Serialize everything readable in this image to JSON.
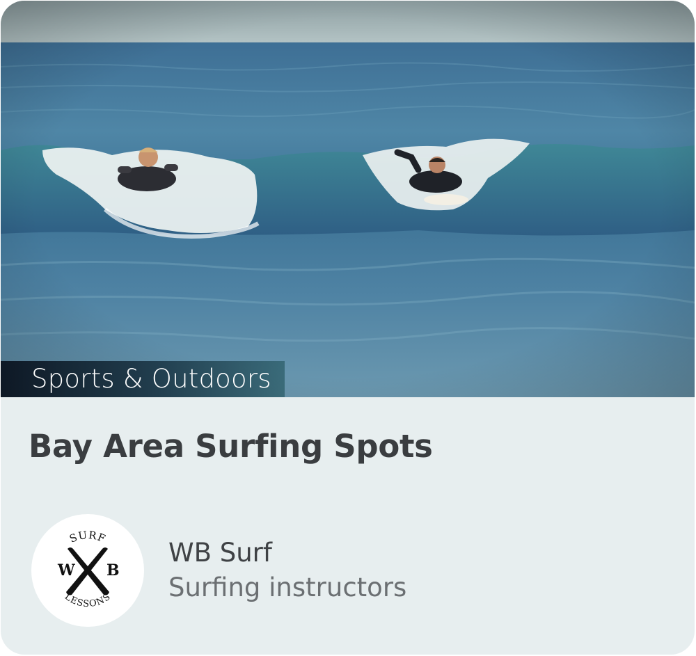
{
  "card": {
    "category": "Sports & Outdoors",
    "title": "Bay Area Surfing Spots",
    "hero_image": "surfers-paddling-on-wave-photo"
  },
  "author": {
    "name": "WB Surf",
    "description": "Surfing instructors",
    "logo": {
      "top_text": "SURF",
      "left_letter": "W",
      "right_letter": "B",
      "bottom_text": "LESSONS"
    }
  },
  "colors": {
    "card_background": "#e7eeef",
    "title_text": "#3a3d40",
    "subtitle_text": "#6b6f72",
    "sea_dark": "#2f5f8a",
    "sea_light": "#5d9ab0",
    "sky": "#9fb4b8"
  }
}
